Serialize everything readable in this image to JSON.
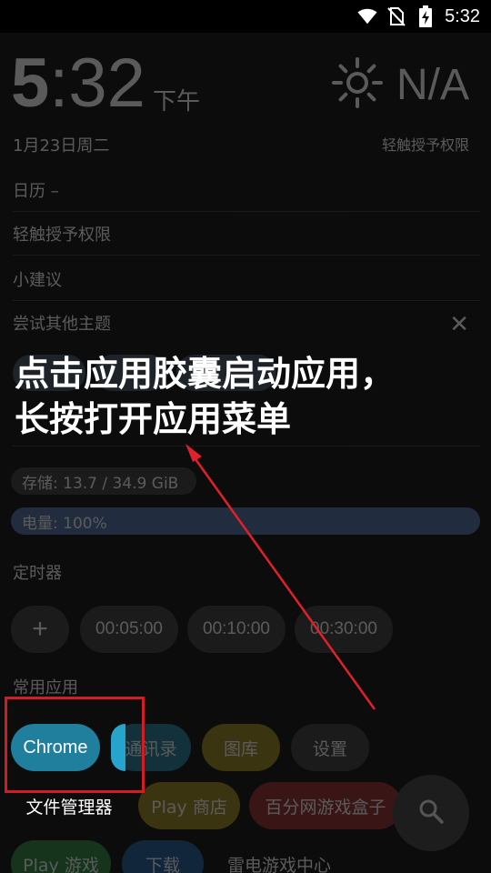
{
  "status_bar": {
    "time": "5:32",
    "icons": [
      "wifi-icon",
      "no-sim-icon",
      "battery-charging-icon"
    ]
  },
  "clock": {
    "hour": "5",
    "separator": ":",
    "minute": "32",
    "ampm": "下午"
  },
  "weather": {
    "icon": "sun-icon",
    "temperature": "N/A"
  },
  "date": "1月23日周二",
  "grant_permission_right": "轻触授予权限",
  "calendar_label": "日历 –",
  "grant_permission_row": "轻触授予权限",
  "suggestions_label": "小建议",
  "try_theme_label": "尝试其他主题",
  "storage_label": "存储: 13.7 / 34.9 GiB",
  "battery_label": "电量: 100%",
  "timer": {
    "label": "定时器",
    "add_label": "+",
    "presets": [
      "00:05:00",
      "00:10:00",
      "00:30:00"
    ]
  },
  "frequent_apps": {
    "label": "常用应用",
    "row1": [
      "Chrome",
      "通讯录",
      "图库",
      "设置"
    ],
    "row2": [
      "文件管理器",
      "Play 商店",
      "百分网游戏盒子"
    ],
    "row3": [
      "Play 游戏",
      "下载",
      "雷电游戏中心"
    ]
  },
  "tutorial": {
    "line1": "点击应用胶囊启动应用，",
    "line2": "长按打开应用菜单"
  },
  "colors": {
    "highlight": "#d11e25",
    "chrome_chip": "#1f7f9c",
    "arrow": "#e0202a"
  },
  "search_icon": "search-icon"
}
